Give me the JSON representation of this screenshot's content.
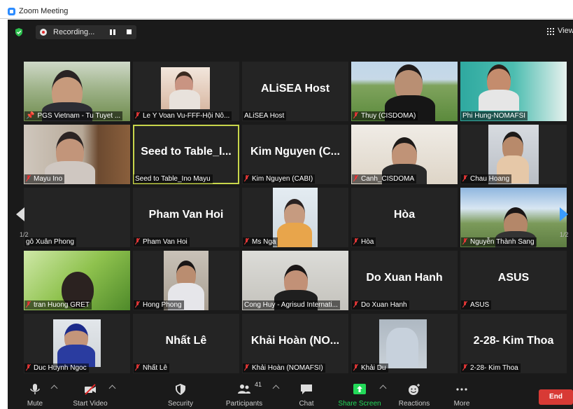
{
  "window": {
    "title": "Zoom Meeting"
  },
  "topbar": {
    "recording_label": "Recording...",
    "view_label": "View",
    "shield_icon": "shield-check-icon"
  },
  "pagination": {
    "left": "1/2",
    "right": "1/2"
  },
  "tiles": [
    {
      "name": "PGS Vietnam - Tu Tuyet ...",
      "big": "",
      "pinned": true
    },
    {
      "name": "Le Y Voan Vu-FFF-Hội Nô...",
      "big": "",
      "muted": true
    },
    {
      "name": "ALiSEA Host",
      "big": "ALiSEA Host"
    },
    {
      "name": "Thuy (CISDOMA)",
      "big": "",
      "muted": true
    },
    {
      "name": "Phi Hung-NOMAFSI",
      "big": ""
    },
    {
      "name": "Mayu Ino",
      "big": "",
      "muted": true
    },
    {
      "name": "Seed to Table_Ino Mayu",
      "big": "Seed to Table_I...",
      "active": true
    },
    {
      "name": "Kim Nguyen (CABI)",
      "big": "Kim Nguyen (C...",
      "muted": true
    },
    {
      "name": "Canh_CISDOMA",
      "big": "",
      "muted": true
    },
    {
      "name": "Chau Hoang",
      "big": "",
      "muted": true
    },
    {
      "name": "gô Xuân Phong",
      "big": ""
    },
    {
      "name": "Pham Van Hoi",
      "big": "Pham Van Hoi",
      "muted": true
    },
    {
      "name": "Ms Nga",
      "big": "",
      "muted": true
    },
    {
      "name": "Hòa",
      "big": "Hòa",
      "muted": true
    },
    {
      "name": "Nguyễn Thành Sang",
      "big": "",
      "muted": true
    },
    {
      "name": "tran Huong GRET",
      "big": "",
      "muted": true
    },
    {
      "name": "Hong Phong",
      "big": "",
      "muted": true
    },
    {
      "name": "Cong Huy - Agrisud Internati...",
      "big": ""
    },
    {
      "name": "Do Xuan Hanh",
      "big": "Do Xuan Hanh",
      "muted": true
    },
    {
      "name": "ASUS",
      "big": "ASUS",
      "muted": true
    },
    {
      "name": "Duc Huynh Ngoc",
      "big": "",
      "muted": true
    },
    {
      "name": "Nhất Lê",
      "big": "Nhất Lê",
      "muted": true
    },
    {
      "name": "Khải Hoàn (NOMAFSI)",
      "big": "Khải Hoàn (NO...",
      "muted": true
    },
    {
      "name": "Khải Du",
      "big": "",
      "muted": true
    },
    {
      "name": "2-28- Kim Thoa",
      "big": "2-28- Kim Thoa",
      "muted": true
    }
  ],
  "toolbar": {
    "mute": "Mute",
    "start_video": "Start Video",
    "security": "Security",
    "participants": "Participants",
    "participants_count": "41",
    "chat": "Chat",
    "share_screen": "Share Screen",
    "reactions": "Reactions",
    "more": "More",
    "end": "End"
  },
  "colors": {
    "active_border": "#c8d64b",
    "share_green": "#23d959",
    "end_red": "#d83a35",
    "muted_red": "#ff4040",
    "next_arrow": "#3a9cff"
  }
}
